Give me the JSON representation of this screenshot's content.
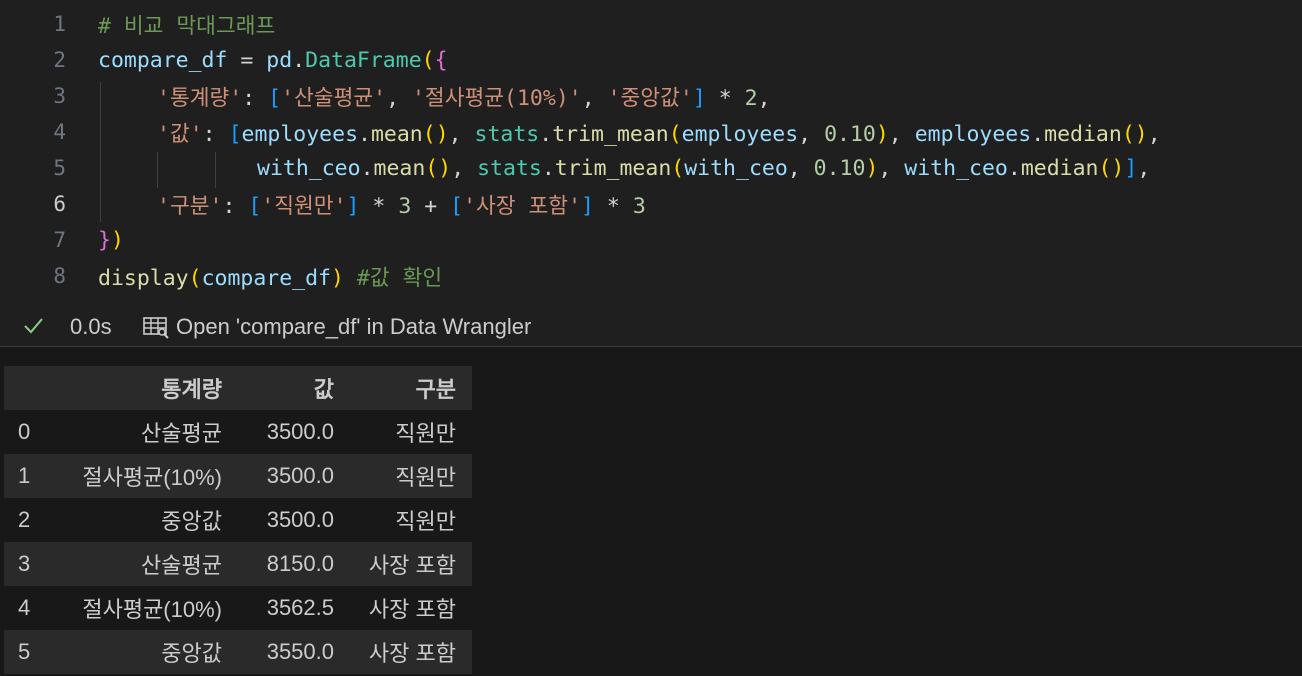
{
  "code": {
    "line_numbers": [
      "1",
      "2",
      "3",
      "4",
      "5",
      "6",
      "7",
      "8"
    ],
    "active_line": "6",
    "line1": {
      "comment": "# 비교 막대그래프"
    },
    "line2": {
      "var": "compare_df",
      "eq": " = ",
      "mod": "pd",
      "dot": ".",
      "cls": "DataFrame",
      "paren": "(",
      "brace": "{"
    },
    "line3": {
      "key": "'통계량'",
      "colon": ": ",
      "lb": "[",
      "s1": "'산술평균'",
      "c1": ", ",
      "s2": "'절사평균(10%)'",
      "c2": ", ",
      "s3": "'중앙값'",
      "rb": "]",
      "mul": " * ",
      "n": "2",
      "comma": ","
    },
    "line4": {
      "key": "'값'",
      "colon": ": ",
      "lb": "[",
      "v1": "employees",
      "d1": ".",
      "f1": "mean",
      "p1": "()",
      "c1": ", ",
      "v2": "stats",
      "d2": ".",
      "f2": "trim_mean",
      "p2o": "(",
      "v3": "employees",
      "c2": ", ",
      "n1": "0.10",
      "p2c": ")",
      "c3": ", ",
      "v4": "employees",
      "d3": ".",
      "f3": "median",
      "p3": "()",
      "c4": ","
    },
    "line5": {
      "v1": "with_ceo",
      "d1": ".",
      "f1": "mean",
      "p1": "()",
      "c1": ", ",
      "v2": "stats",
      "d2": ".",
      "f2": "trim_mean",
      "p2o": "(",
      "v3": "with_ceo",
      "c2": ", ",
      "n1": "0.10",
      "p2c": ")",
      "c3": ", ",
      "v4": "with_ceo",
      "d3": ".",
      "f3": "median",
      "p3": "()",
      "rb": "]",
      "c4": ","
    },
    "line6": {
      "key": "'구분'",
      "colon": ": ",
      "lb1": "[",
      "s1": "'직원만'",
      "rb1": "]",
      "mul1": " * ",
      "n1": "3",
      "plus": " + ",
      "lb2": "[",
      "s2": "'사장 포함'",
      "rb2": "]",
      "mul2": " * ",
      "n2": "3"
    },
    "line7": {
      "brace": "}",
      "paren": ")"
    },
    "line8": {
      "fn": "display",
      "po": "(",
      "var": "compare_df",
      "pc": ")",
      "sp": " ",
      "comment": "#값 확인"
    }
  },
  "status": {
    "exec_time": "0.0s",
    "wrangler_label": "Open 'compare_df' in Data Wrangler",
    "check_icon": "check-icon",
    "wrangler_icon": "table-icon"
  },
  "dataframe": {
    "columns": [
      "",
      "통계량",
      "값",
      "구분"
    ],
    "rows": [
      {
        "index": "0",
        "stat": "산술평균",
        "value": "3500.0",
        "group": "직원만"
      },
      {
        "index": "1",
        "stat": "절사평균(10%)",
        "value": "3500.0",
        "group": "직원만"
      },
      {
        "index": "2",
        "stat": "중앙값",
        "value": "3500.0",
        "group": "직원만"
      },
      {
        "index": "3",
        "stat": "산술평균",
        "value": "8150.0",
        "group": "사장 포함"
      },
      {
        "index": "4",
        "stat": "절사평균(10%)",
        "value": "3562.5",
        "group": "사장 포함"
      },
      {
        "index": "5",
        "stat": "중앙값",
        "value": "3550.0",
        "group": "사장 포함"
      }
    ]
  }
}
